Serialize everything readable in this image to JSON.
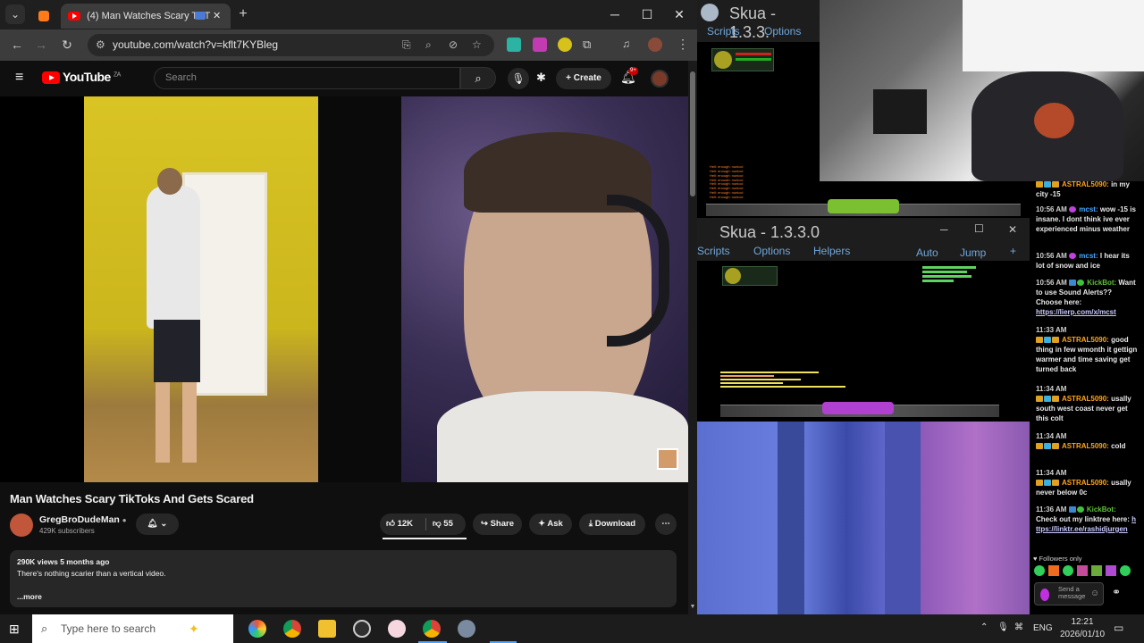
{
  "browser": {
    "tabs": [
      {
        "label": ""
      },
      {
        "label": "(4) Man Watches Scary TikT"
      }
    ],
    "new_tab": "+",
    "url": "youtube.com/watch?v=kflt7KYBleg",
    "window_controls": {
      "minimize": "─",
      "maximize": "☐",
      "close": "✕"
    }
  },
  "youtube": {
    "logo_text": "YouTube",
    "region": "ZA",
    "search_placeholder": "Search",
    "create_label": "Create",
    "notification_count": "9+",
    "video": {
      "title": "Man Watches Scary TikToks And Gets Scared",
      "channel": "GregBroDudeMan",
      "subscribers": "429K subscribers",
      "likes": "12K",
      "dislikes": "55",
      "share_label": "Share",
      "ask_label": "Ask",
      "download_label": "Download",
      "views_date": "290K views  5 months ago",
      "description": "There's nothing scarier than a vertical video.",
      "more_label": "...more"
    }
  },
  "skua1": {
    "title": "Skua - 1.3.3.",
    "menu": [
      "Scripts",
      "Options"
    ],
    "log_lines": [
      "Hell: enough: nunlocl",
      "Hell: enough: nunlocl",
      "Hell: enough: nunlocl",
      "Hell: enough: nunlocl",
      "Hell: enough: nunlocl",
      "Hell: enough: nunlocl",
      "Hell: enough: nunlocl",
      "Hell: enough: nunlocl"
    ]
  },
  "skua2": {
    "title": "Skua - 1.3.3.0",
    "menu": [
      "Scripts",
      "Options",
      "Helpers"
    ],
    "right_menu": [
      "Auto",
      "Jump"
    ],
    "plus": "+",
    "window_controls": {
      "minimize": "─",
      "maximize": "☐",
      "close": "✕"
    }
  },
  "chat": {
    "messages": [
      {
        "time": "",
        "name": "ASTRAL5090:",
        "text": "in my city -15",
        "color": "o",
        "top_partial": true
      },
      {
        "time": "10:56 AM",
        "name": "mcst:",
        "text": "wow -15 is insane. I dont think ive ever experienced minus weather",
        "color": "b"
      },
      {
        "time": "10:56 AM",
        "name": "mcst:",
        "text": "I hear its lot of snow and ice",
        "color": "b"
      },
      {
        "time": "10:56 AM",
        "name": "KickBot:",
        "text": "Want to use Sound Alerts?? Choose here:",
        "link": "https://lierp.com/x/mcst",
        "color": "k"
      },
      {
        "time": "11:33 AM",
        "name": "ASTRAL5090:",
        "text": "good thing in few wmonth it gettign warmer and time saving get turned back",
        "color": "o"
      },
      {
        "time": "11:34 AM",
        "name": "ASTRAL5090:",
        "text": "usally south west coast never get this colt",
        "color": "o"
      },
      {
        "time": "11:34 AM",
        "name": "ASTRAL5090:",
        "text": "cold",
        "color": "o"
      },
      {
        "time": "11:34 AM",
        "name": "ASTRAL5090:",
        "text": "usally never below 0c",
        "color": "o"
      },
      {
        "time": "11:36 AM",
        "name": "KickBot:",
        "text": "Check out my linktree here:",
        "link": "https://linktr.ee/rashidjurgen",
        "color": "k"
      }
    ],
    "followers_only": "Followers only",
    "send_placeholder": "Send a message"
  },
  "taskbar": {
    "search_placeholder": "Type here to search",
    "lang": "ENG",
    "time": "12:21",
    "date": "2026/01/10"
  },
  "colors": {
    "yt_red": "#ff0000",
    "chat_orange": "#ffa51a",
    "chat_blue": "#49a6ff",
    "chat_green": "#5fbf3a",
    "skua_menu": "#6fa8dc"
  }
}
